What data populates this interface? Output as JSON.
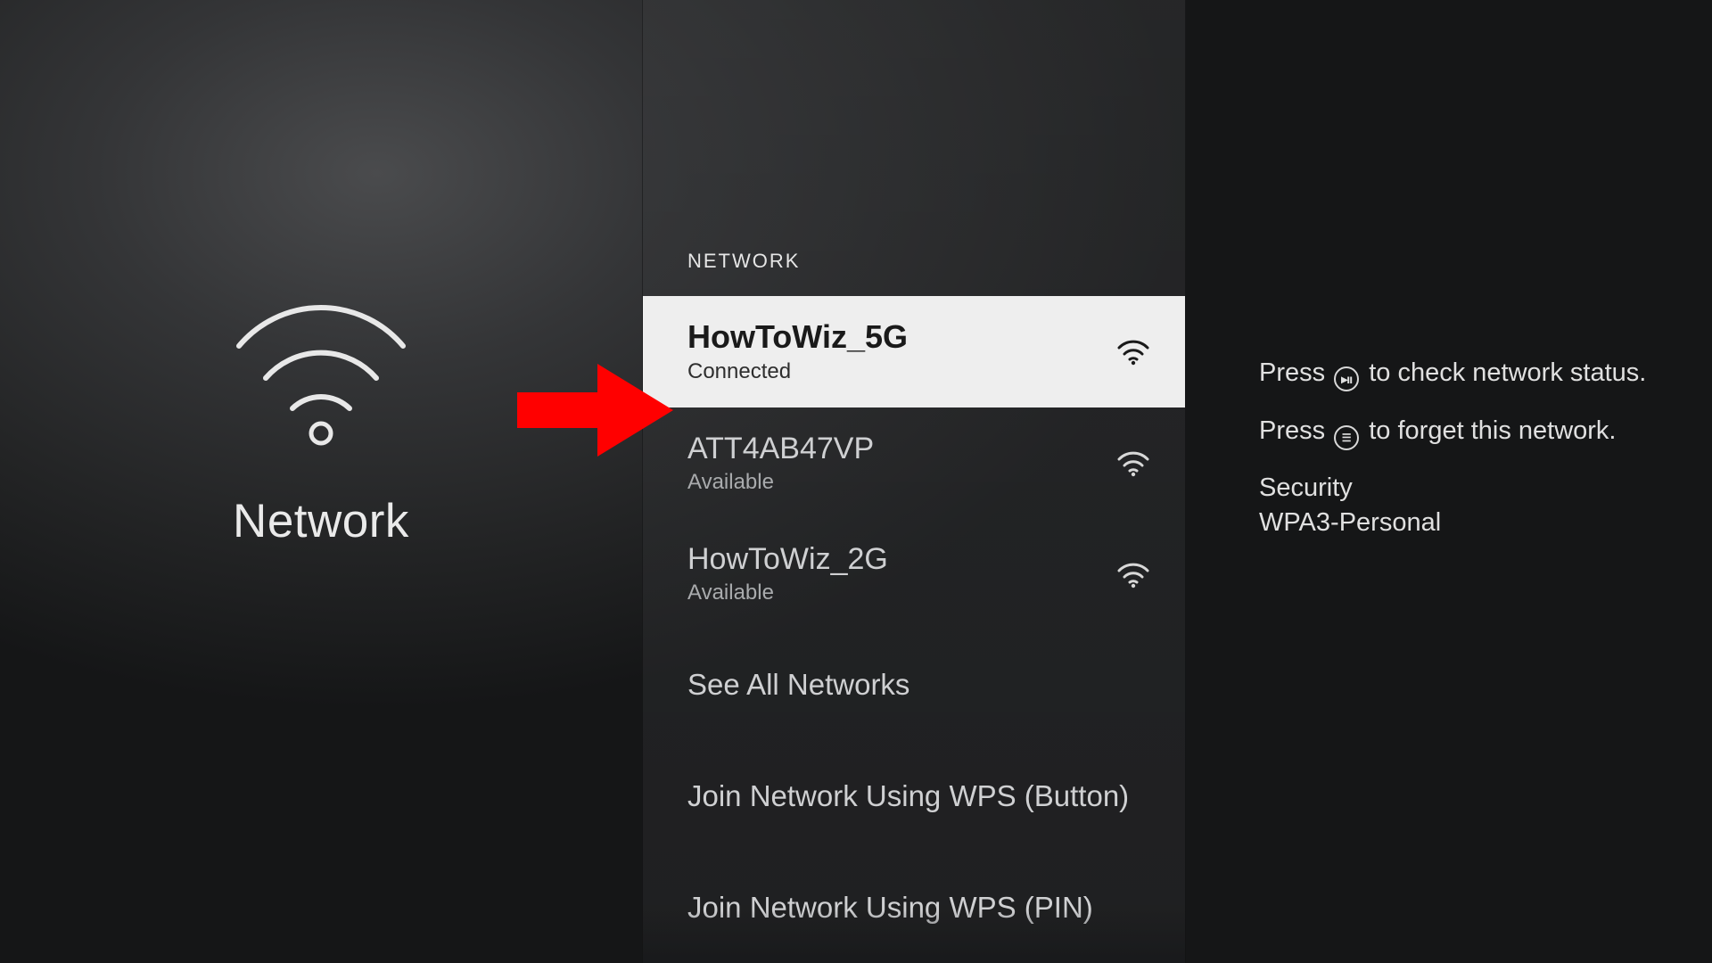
{
  "left": {
    "title": "Network"
  },
  "mid": {
    "section_header": "NETWORK",
    "networks": [
      {
        "name": "HowToWiz_5G",
        "status": "Connected"
      },
      {
        "name": "ATT4AB47VP",
        "status": "Available"
      },
      {
        "name": "HowToWiz_2G",
        "status": "Available"
      }
    ],
    "see_all": "See All Networks",
    "wps_button": "Join Network Using WPS (Button)",
    "wps_pin": "Join Network Using WPS (PIN)"
  },
  "right": {
    "hint1_pre": "Press ",
    "hint1_post": " to check network status.",
    "hint2_pre": "Press ",
    "hint2_post": " to forget this network.",
    "security_label": "Security",
    "security_value": "WPA3-Personal"
  }
}
